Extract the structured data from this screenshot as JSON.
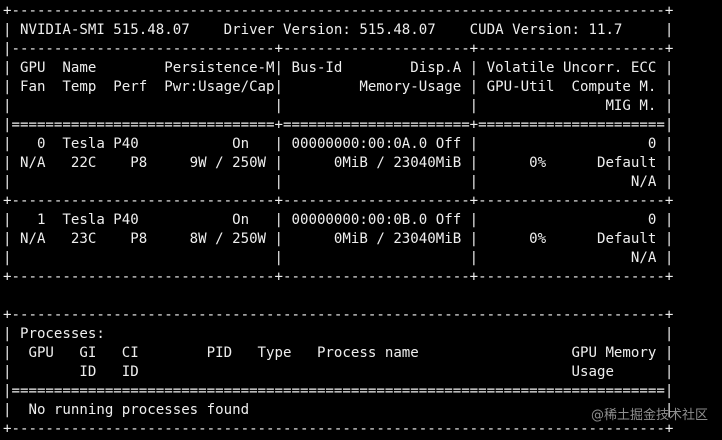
{
  "terminal": {
    "lines": [
      "+-----------------------------------------------------------------------------+",
      "| NVIDIA-SMI 515.48.07    Driver Version: 515.48.07    CUDA Version: 11.7     |",
      "|-------------------------------+----------------------+----------------------+",
      "| GPU  Name        Persistence-M| Bus-Id        Disp.A | Volatile Uncorr. ECC |",
      "| Fan  Temp  Perf  Pwr:Usage/Cap|         Memory-Usage | GPU-Util  Compute M. |",
      "|                               |                      |               MIG M. |",
      "|===============================+======================+======================|",
      "|   0  Tesla P40           On   | 00000000:00:0A.0 Off |                    0 |",
      "| N/A   22C    P8     9W / 250W |      0MiB / 23040MiB |      0%      Default |",
      "|                               |                      |                  N/A |",
      "+-------------------------------+----------------------+----------------------+",
      "|   1  Tesla P40           On   | 00000000:00:0B.0 Off |                    0 |",
      "| N/A   23C    P8     8W / 250W |      0MiB / 23040MiB |      0%      Default |",
      "|                               |                      |                  N/A |",
      "+-------------------------------+----------------------+----------------------+",
      "",
      "+-----------------------------------------------------------------------------+",
      "| Processes:                                                                  |",
      "|  GPU   GI   CI        PID   Type   Process name                  GPU Memory |",
      "|        ID   ID                                                   Usage      |",
      "|=============================================================================|",
      "|  No running processes found                                                 |",
      "+-----------------------------------------------------------------------------+"
    ]
  },
  "watermark": {
    "text": "@稀土掘金技术社区"
  }
}
